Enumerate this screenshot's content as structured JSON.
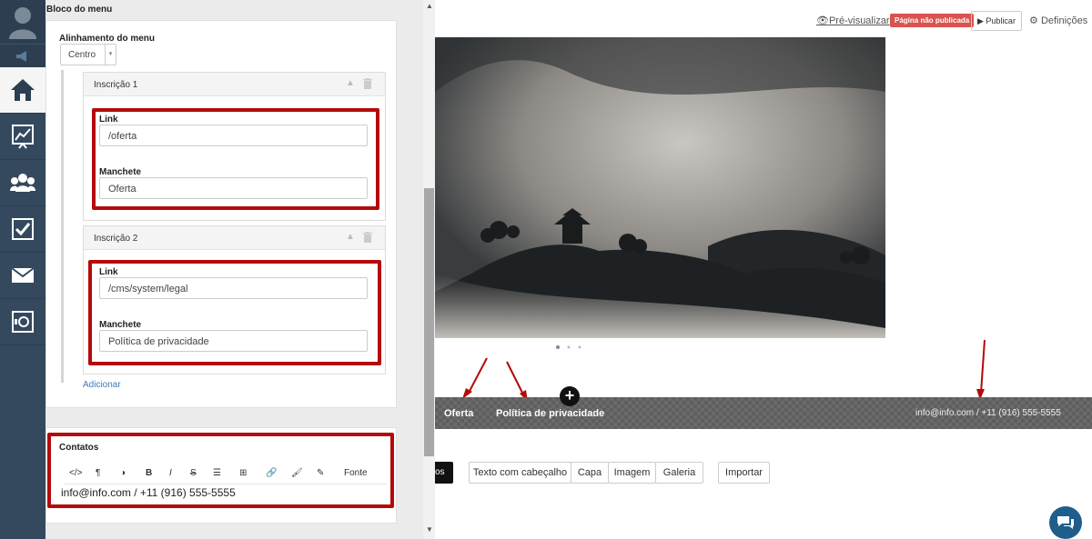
{
  "panel": {
    "section_title": "Bloco do menu",
    "alignment_label": "Alinhamento do menu",
    "alignment_value": "Centro",
    "items": [
      {
        "title": "Inscrição 1",
        "link_label": "Link",
        "link_value": "/oferta",
        "headline_label": "Manchete",
        "headline_value": "Oferta"
      },
      {
        "title": "Inscrição 2",
        "link_label": "Link",
        "link_value": "/cms/system/legal",
        "headline_label": "Manchete",
        "headline_value": "Política de privacidade"
      }
    ],
    "add_label": "Adicionar",
    "contacts_label": "Contatos",
    "toolbar": [
      "</>",
      "¶",
      "◑",
      "B",
      "I",
      "S",
      "☰",
      "⊞",
      "🔗",
      "🖌",
      "✎",
      "Fonte"
    ],
    "contacts_value": "info@info.com / +11 (916) 555-5555"
  },
  "topbar": {
    "preview_label": "Pré-visualizar",
    "status_badge": "Página não publicada",
    "publish_label": "Publicar",
    "settings_label": "Definições"
  },
  "footer": {
    "link1": "Oferta",
    "link2": "Política de privacidade",
    "contact": "info@info.com / +11 (916) 555-5555"
  },
  "blocks": {
    "partial": "os",
    "buttons": [
      "Texto com cabeçalho",
      "Capa",
      "Imagem",
      "Galeria"
    ],
    "import_label": "Importar"
  },
  "colors": {
    "sidebar": "#34495e",
    "highlight": "#b40a0a",
    "badge": "#d9534f",
    "link": "#3a7bbf"
  },
  "icons": [
    "user-avatar-icon",
    "megaphone-icon",
    "home-icon",
    "chart-icon",
    "users-icon",
    "checkbox-icon",
    "mail-icon",
    "safe-icon",
    "chat-icon"
  ]
}
